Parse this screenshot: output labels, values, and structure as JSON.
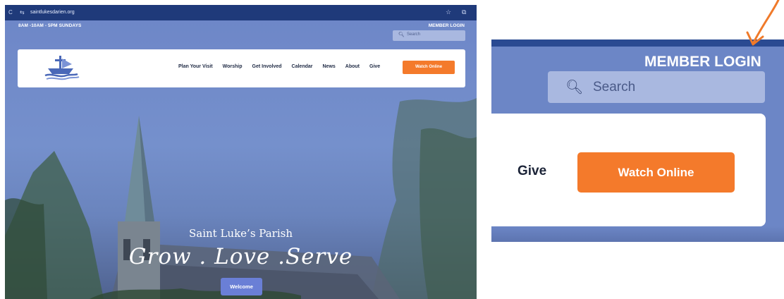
{
  "browser": {
    "url": "saintlukesdarien.org",
    "reload_icon": "reload-icon",
    "site_settings_icon": "tune-icon",
    "bookmark_icon": "star-icon",
    "extension_icon": "extension-icon"
  },
  "utility": {
    "hours": "8AM -10AM - 5PM SUNDAYS",
    "member_login": "MEMBER LOGIN",
    "search_placeholder": "Search"
  },
  "nav": {
    "items": [
      "Plan Your Visit",
      "Worship",
      "Get Involved",
      "Calendar",
      "News",
      "About",
      "Give"
    ],
    "watch_online": "Watch Online"
  },
  "hero": {
    "parish": "Saint Luke’s Parish",
    "tagline": "Grow . Love .Serve",
    "welcome": "Welcome"
  },
  "zoom": {
    "member_login": "MEMBER LOGIN",
    "search_placeholder": "Search",
    "give": "Give",
    "watch_online": "Watch Online"
  },
  "colors": {
    "accent_orange": "#f47a2b",
    "hero_blue": "#6f87c6",
    "chrome_blue": "#1f3a7a",
    "welcome_blue": "#6a7fd6",
    "annotation_arrow": "#f07a2a"
  }
}
